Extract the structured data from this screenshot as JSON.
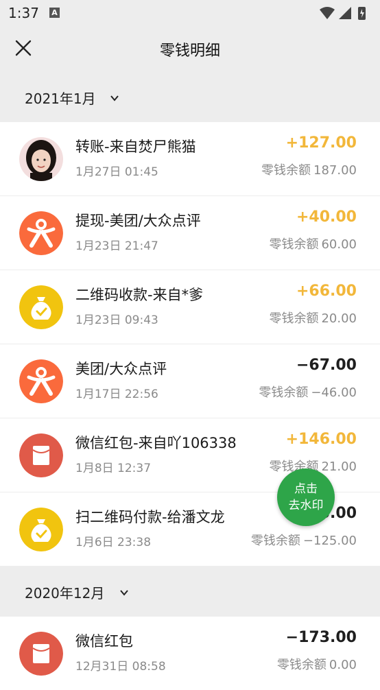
{
  "status_bar": {
    "time": "1:37",
    "notification_badge": "A"
  },
  "nav": {
    "title": "零钱明细"
  },
  "sections": [
    {
      "month": "2021年1月",
      "items": [
        {
          "title": "转账-来自焚尸熊猫",
          "date": "1月27日 01:45",
          "amount": "+127.00",
          "balance_label": "零钱余额",
          "balance": "187.00",
          "icon": "user-photo-avatar",
          "sign": "pos"
        },
        {
          "title": "提现-美团/大众点评",
          "date": "1月23日 21:47",
          "amount": "+40.00",
          "balance_label": "零钱余额",
          "balance": "60.00",
          "icon": "meituan-logo-icon",
          "sign": "pos"
        },
        {
          "title": "二维码收款-来自*爹",
          "date": "1月23日 09:43",
          "amount": "+66.00",
          "balance_label": "零钱余额",
          "balance": "20.00",
          "icon": "money-bag-icon",
          "sign": "pos"
        },
        {
          "title": "美团/大众点评",
          "date": "1月17日 22:56",
          "amount": "−67.00",
          "balance_label": "零钱余额",
          "balance": "−46.00",
          "icon": "meituan-logo-icon",
          "sign": "neg"
        },
        {
          "title": "微信红包-来自吖106338",
          "date": "1月8日 12:37",
          "amount": "+146.00",
          "balance_label": "零钱余额",
          "balance": "21.00",
          "icon": "red-packet-icon",
          "sign": "pos"
        },
        {
          "title": "扫二维码付款-给潘文龙",
          "date": "1月6日 23:38",
          "amount": "−5.00",
          "balance_label": "零钱余额",
          "balance": "−125.00",
          "icon": "money-bag-icon",
          "sign": "neg"
        }
      ]
    },
    {
      "month": "2020年12月",
      "items": [
        {
          "title": "微信红包",
          "date": "12月31日 08:58",
          "amount": "−173.00",
          "balance_label": "零钱余额",
          "balance": "0.00",
          "icon": "red-packet-icon",
          "sign": "neg"
        }
      ]
    }
  ],
  "float_button": {
    "line1": "点击",
    "line2": "去水印"
  },
  "colors": {
    "positive": "#f2b73a",
    "negative": "#1e1e1e",
    "meituan": "#fa6a3c",
    "money_bag": "#f1c40f",
    "red_packet": "#e05a49",
    "float_button": "#2ea549"
  }
}
